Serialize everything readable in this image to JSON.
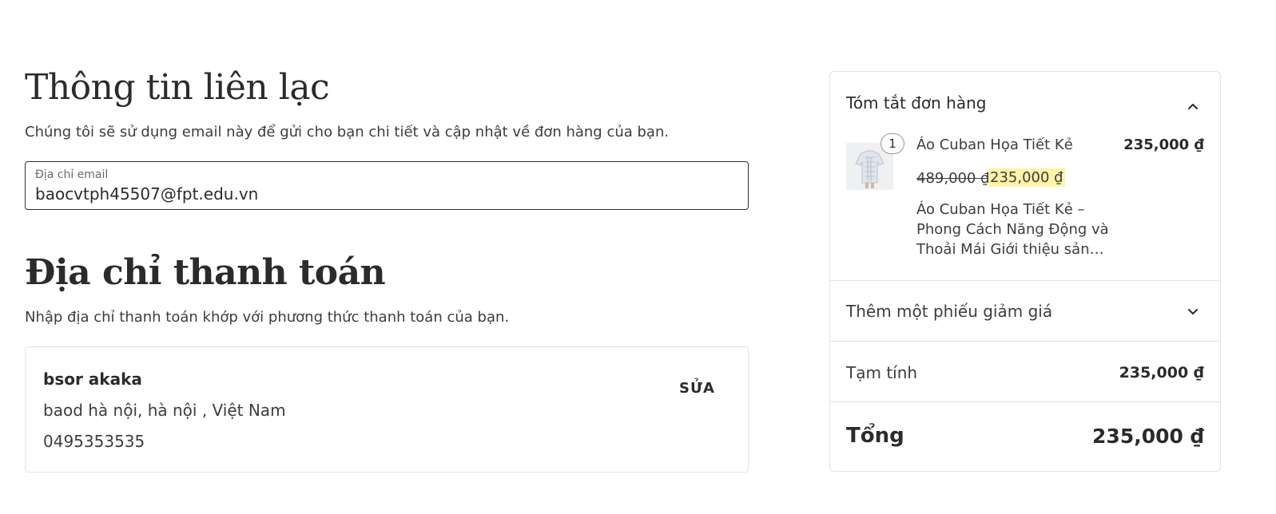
{
  "contact": {
    "title": "Thông tin liên lạc",
    "subtitle": "Chúng tôi sẽ sử dụng email này để gửi cho bạn chi tiết và cập nhật về đơn hàng của bạn.",
    "email_label": "Địa chỉ email",
    "email_value": "baocvtph45507@fpt.edu.vn"
  },
  "billing": {
    "title": "Địa chỉ thanh toán",
    "subtitle": "Nhập địa chỉ thanh toán khớp với phương thức thanh toán của bạn.",
    "name": "bsor akaka",
    "address": "baod hà nội, hà nội , Việt Nam",
    "phone": "0495353535",
    "edit_label": "SỬA"
  },
  "summary": {
    "title": "Tóm tắt đơn hàng",
    "item": {
      "quantity": "1",
      "name": "Áo Cuban Họa Tiết Kẻ",
      "price": "235,000 ₫",
      "old_price": "489,000 ₫",
      "sale_price": "235,000 ₫",
      "description": "Áo Cuban Họa Tiết Kẻ – Phong Cách Năng Động và Thoải Mái Giới thiệu sản…"
    },
    "coupon_label": "Thêm một phiếu giảm giá",
    "subtotal_label": "Tạm tính",
    "subtotal_value": "235,000 ₫",
    "total_label": "Tổng",
    "total_value": "235,000 ₫"
  },
  "colors": {
    "text": "#2b2b2b",
    "border": "#e3e3e3",
    "highlight": "#fff3a8"
  },
  "icons": [
    "chevron-up-icon",
    "chevron-down-icon",
    "product-thumbnail"
  ]
}
